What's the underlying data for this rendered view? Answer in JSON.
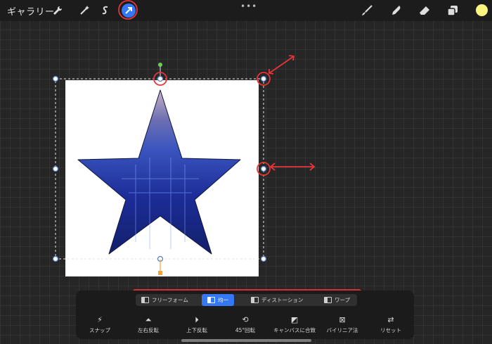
{
  "topbar": {
    "gallery_label": "ギャラリー",
    "left_tools": [
      "wrench-icon",
      "magic-wand-icon",
      "selection-s-icon",
      "transform-arrow-icon"
    ],
    "right_tools": [
      "brush-icon",
      "smudge-icon",
      "eraser-icon",
      "layers-icon"
    ],
    "more": "•••",
    "color": "#f9f57e"
  },
  "transform_modes": [
    {
      "label": "フリーフォーム",
      "active": false
    },
    {
      "label": "均一",
      "active": true
    },
    {
      "label": "ディストーション",
      "active": false
    },
    {
      "label": "ワープ",
      "active": false
    }
  ],
  "tools": [
    {
      "icon": "⚡",
      "label": "スナップ"
    },
    {
      "icon": "⏶",
      "label": "左右反転"
    },
    {
      "icon": "⏵",
      "label": "上下反転"
    },
    {
      "icon": "⟲",
      "label": "45°回転"
    },
    {
      "icon": "◩",
      "label": "キャンバスに合致"
    },
    {
      "icon": "⊠",
      "label": "バイリニア法"
    },
    {
      "icon": "⇄",
      "label": "リセット"
    }
  ],
  "colors": {
    "accent": "#3478f6",
    "annotation": "#e8333a",
    "handle": "#5b7ec9",
    "rotate_handle": "#6bcf55",
    "pivot": "#f2a33a"
  }
}
